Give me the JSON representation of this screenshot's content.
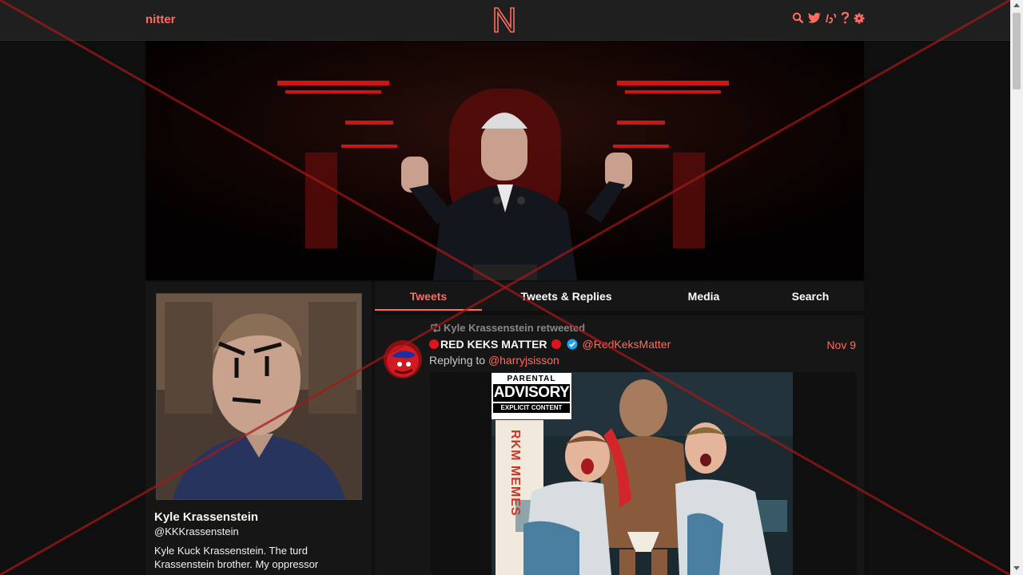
{
  "nav": {
    "brand": "nitter",
    "icons": [
      "search-icon",
      "twitter-icon",
      "rss-icon",
      "help-icon",
      "settings-icon"
    ]
  },
  "profile": {
    "fullname": "Kyle Krassenstein",
    "username": "@KKKrassenstein",
    "bio": "Kyle Kuck Krassenstein.  The turd\nKrassenstein brother.  My oppressor"
  },
  "tabs": [
    {
      "label": "Tweets",
      "active": true
    },
    {
      "label": "Tweets & Replies",
      "active": false
    },
    {
      "label": "Media",
      "active": false
    },
    {
      "label": "Search",
      "active": false
    }
  ],
  "tweet": {
    "retweet_label": "Kyle Krassenstein retweeted",
    "name": "RED KEKS MATTER",
    "handle": "@RedKeksMatter",
    "date": "Nov 9",
    "replying_prefix": "Replying to",
    "replying_handle": "@harryjsisson",
    "media_text": {
      "advisory_top": "PARENTAL",
      "advisory_mid": "ADVISORY",
      "advisory_bottom": "EXPLICIT CONTENT",
      "sign": "RKM MEMES"
    }
  },
  "colors": {
    "accent": "#ff6c60",
    "background": "#0f0f0f",
    "panel": "#161616",
    "navbar": "#1f1f1f"
  }
}
